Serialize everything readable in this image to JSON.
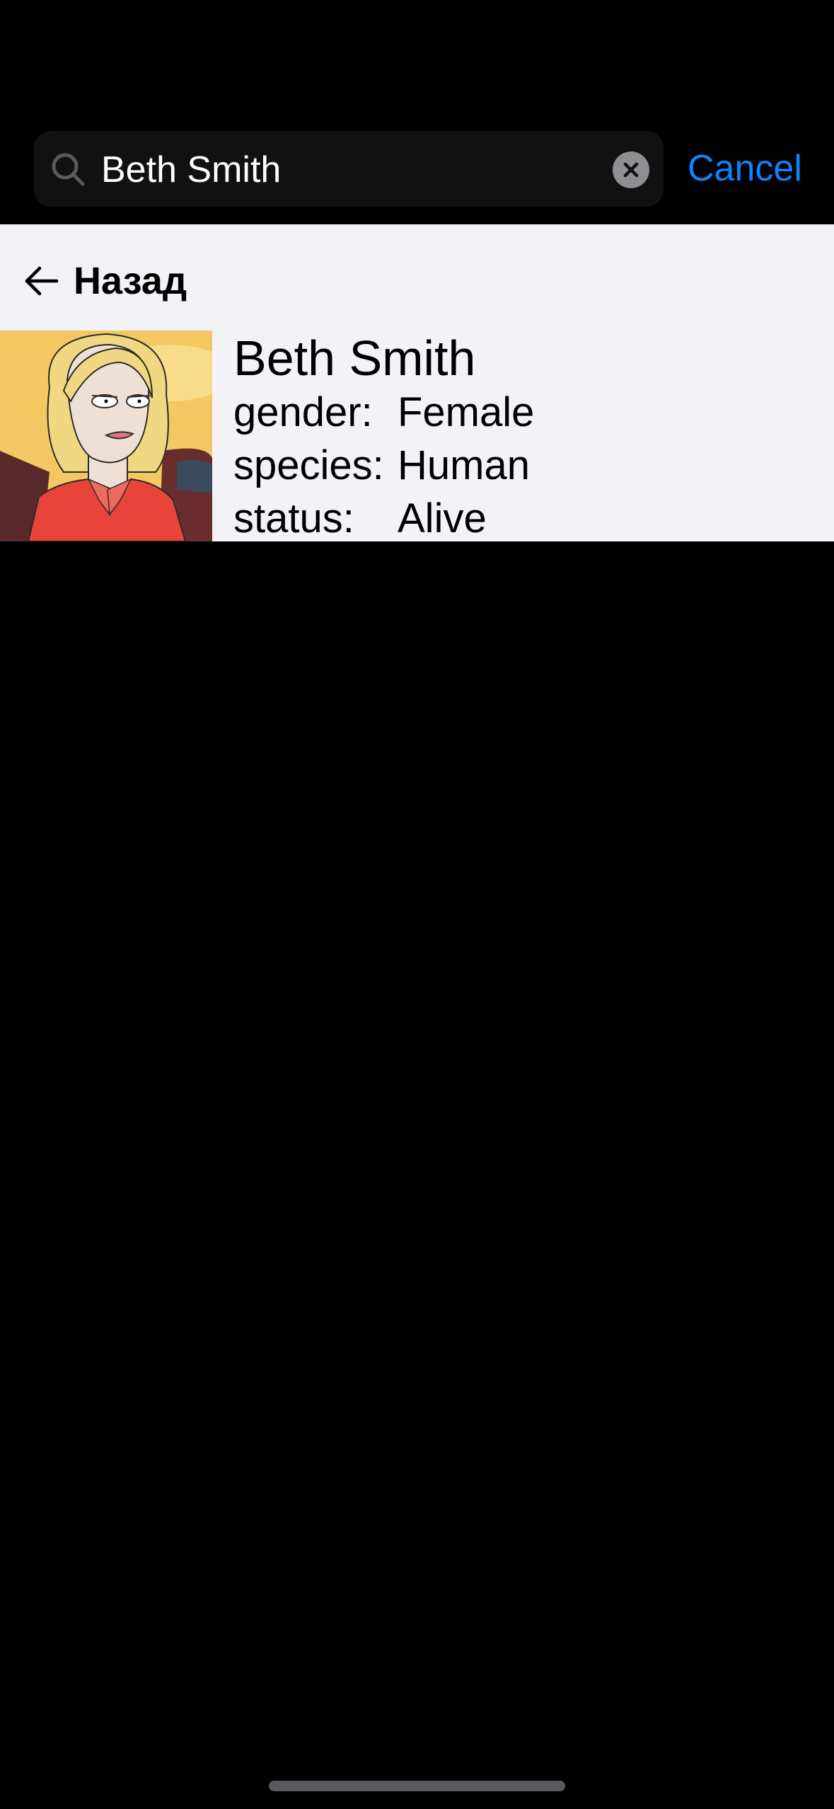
{
  "search": {
    "query": "Beth Smith",
    "icon": "magnifying-glass",
    "clear_icon": "xmark-circle-fill",
    "cancel_label": "Cancel"
  },
  "nav": {
    "back_label": "Назад",
    "back_icon": "arrow-left"
  },
  "character": {
    "name": "Beth Smith",
    "gender_label": "gender:",
    "gender": "Female",
    "species_label": "species:",
    "species": "Human",
    "status_label": "status:",
    "status": "Alive"
  },
  "colors": {
    "background": "#000000",
    "search_field": "#111111",
    "accent": "#0a84ff",
    "panel": "#f2f2f7",
    "text_primary": "#000000",
    "text_on_dark": "#ffffff"
  }
}
